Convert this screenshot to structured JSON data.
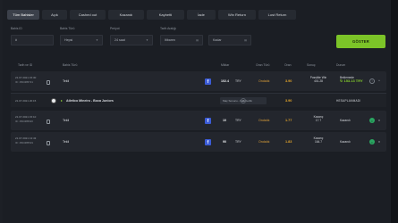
{
  "tabs": [
    {
      "label": "Tüm Bahisler",
      "active": true
    },
    {
      "label": "Açık",
      "active": false
    },
    {
      "label": "Cashed out",
      "active": false
    },
    {
      "label": "Kazandı",
      "active": false
    },
    {
      "label": "Kaybetti",
      "active": false
    },
    {
      "label": "İade",
      "active": false
    },
    {
      "label": "Win Return",
      "active": false
    },
    {
      "label": "Lost Return",
      "active": false
    }
  ],
  "filters": {
    "bet_id": {
      "label": "Bahis ID",
      "value": "#"
    },
    "bet_type": {
      "label": "Bahis Türü",
      "value": "Hepsi"
    },
    "period": {
      "label": "Periyot",
      "value": "24 saat"
    },
    "date_range": {
      "label": "Tarih Aralığı",
      "from": "Itibaren",
      "to": "Kadar"
    },
    "search_label": "GÖSTER"
  },
  "table_headers": {
    "date_id": "Tarih ve ID",
    "bet_type": "Bahis Türü",
    "amount": "Miktar",
    "odds_type": "Oran Türü",
    "odds": "Oran",
    "result": "Sonuç",
    "status": "Durum"
  },
  "rows": [
    {
      "date": "21.07.2021 15:30",
      "id": "ID: 1564385721",
      "type": "Tekli",
      "amount": "102.4",
      "currency": "TRY",
      "odds_type": "Ondalık",
      "odds": "3.90",
      "result_line1": "Possible Win",
      "result_line2": "401.28",
      "status_line1": "Beklemede",
      "status_line2": "↻ 153.13 TRY",
      "expanded": true
    },
    {
      "date": "21.07.2021 15:10",
      "id": "ID: 1564385620",
      "type": "Tekli",
      "amount": "10",
      "currency": "TRY",
      "odds_type": "Ondalık",
      "odds": "1.77",
      "result_line1": "Kazanç",
      "result_line2": "17.7",
      "status_line1": "Kazandı"
    },
    {
      "date": "21.07.2021 13:43",
      "id": "ID: 1564385519",
      "type": "Tekli",
      "amount": "90",
      "currency": "TRY",
      "odds_type": "Ondalık",
      "odds": "1.83",
      "result_line1": "Kazanç",
      "result_line2": "164.7",
      "status_line1": "Kazandı"
    }
  ],
  "subrow": {
    "date": "21.07.2021 20:15",
    "match": "Atletico Mineiro - Boca Juniors",
    "market": "Maç Sonucu - Beraberlik",
    "odds": "3.90",
    "action": "HESAPLANMADI"
  },
  "colors": {
    "accent_green": "#7cc428",
    "odds_orange": "#e3a52b",
    "status_green": "#2aa561"
  }
}
